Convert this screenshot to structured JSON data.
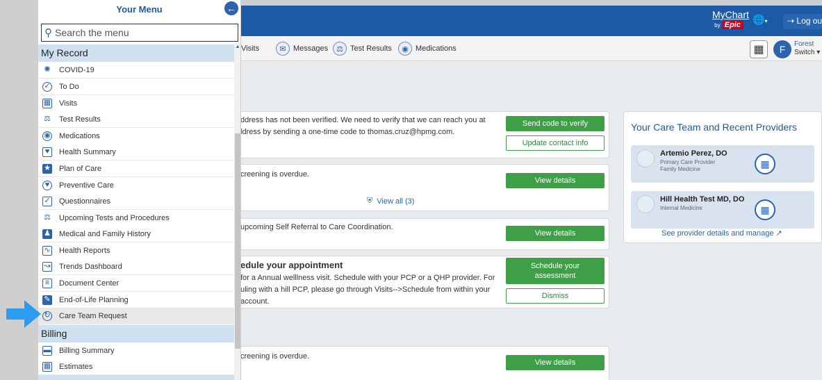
{
  "header": {
    "brand_top": "MyChart",
    "brand_by": "by",
    "brand_epic": "Epic",
    "logout": "Log out"
  },
  "nav": {
    "items": [
      {
        "label": "Visits"
      },
      {
        "label": "Messages"
      },
      {
        "label": "Test Results"
      },
      {
        "label": "Medications"
      }
    ],
    "avatar_initial": "F",
    "user_name": "Forest",
    "switch_label": "Switch"
  },
  "cards": {
    "verify_text_1": "ddress has not been verified. We need to verify that we can reach you at",
    "verify_text_2": "ldress by sending a one-time code to thomas.cruz@hpmg.com.",
    "send_code": "Send code to verify",
    "update_contact": "Update contact info",
    "screening_text": "creening is overdue.",
    "view_details": "View details",
    "view_all": "View all (3)",
    "referral_text": "upcoming Self Referral to Care Coordination.",
    "schedule_title": "edule your appointment",
    "schedule_text_1": "for a Annual welllness visit. Schedule with your PCP or a QHP provider. For",
    "schedule_text_2": "uling with a hill PCP, please go through Visits-->Schedule from within your",
    "schedule_text_3": "account.",
    "schedule_btn": "Schedule your assessment",
    "dismiss": "Dismiss",
    "screening_text_2": "creening is overdue."
  },
  "care_team": {
    "title": "Your Care Team and Recent Providers",
    "providers": [
      {
        "name": "Artemio Perez, DO",
        "role": "Primary Care Provider",
        "dept": "Family Medicine"
      },
      {
        "name": "Hill Health Test MD, DO",
        "role": "Internal Medicine",
        "dept": ""
      }
    ],
    "see_details": "See provider details and manage"
  },
  "menu": {
    "title": "Your Menu",
    "search_placeholder": "Search the menu",
    "sections": [
      {
        "title": "My Record",
        "items": [
          {
            "label": "COVID-19",
            "icon": "virus-icon"
          },
          {
            "label": "To Do",
            "icon": "checkmark-circle-icon"
          },
          {
            "label": "Visits",
            "icon": "calendar-icon"
          },
          {
            "label": "Test Results",
            "icon": "flask-icon"
          },
          {
            "label": "Medications",
            "icon": "pills-icon"
          },
          {
            "label": "Health Summary",
            "icon": "heart-document-icon"
          },
          {
            "label": "Plan of Care",
            "icon": "plan-of-care-icon"
          },
          {
            "label": "Preventive Care",
            "icon": "shield-icon"
          },
          {
            "label": "Questionnaires",
            "icon": "clipboard-icon"
          },
          {
            "label": "Upcoming Tests and Procedures",
            "icon": "flask-clock-icon"
          },
          {
            "label": "Medical and Family History",
            "icon": "family-history-icon"
          },
          {
            "label": "Health Reports",
            "icon": "health-report-icon"
          },
          {
            "label": "Trends Dashboard",
            "icon": "trend-chart-icon"
          },
          {
            "label": "Document Center",
            "icon": "document-icon"
          },
          {
            "label": "End-of-Life Planning",
            "icon": "end-of-life-icon"
          },
          {
            "label": "Care Team Request",
            "icon": "care-team-icon"
          }
        ]
      },
      {
        "title": "Billing",
        "items": [
          {
            "label": "Billing Summary",
            "icon": "credit-card-icon"
          },
          {
            "label": "Estimates",
            "icon": "calculator-icon"
          }
        ]
      }
    ]
  },
  "colors": {
    "brand_blue": "#1d5aa5",
    "section_bg": "#cfe0f1",
    "action_green": "#3e9f47",
    "arrow_blue": "#2d9bf0"
  }
}
